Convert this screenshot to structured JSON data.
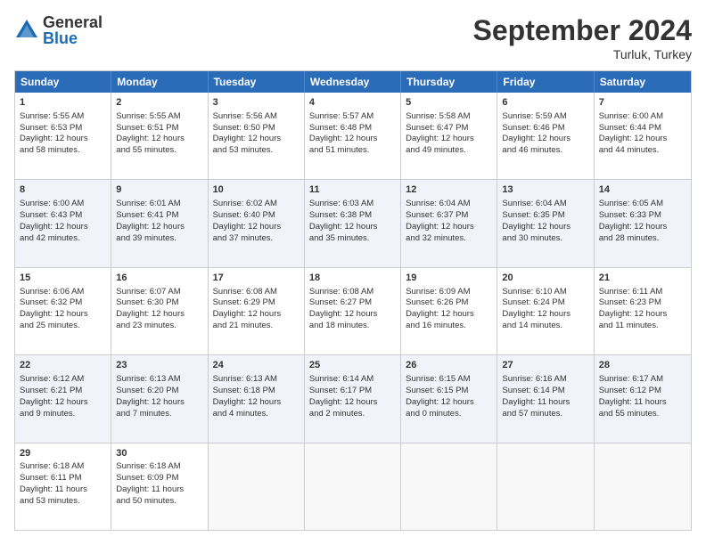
{
  "logo": {
    "general": "General",
    "blue": "Blue"
  },
  "header": {
    "month": "September 2024",
    "location": "Turluk, Turkey"
  },
  "weekdays": [
    "Sunday",
    "Monday",
    "Tuesday",
    "Wednesday",
    "Thursday",
    "Friday",
    "Saturday"
  ],
  "rows": [
    [
      {
        "day": "1",
        "info": "Sunrise: 5:55 AM\nSunset: 6:53 PM\nDaylight: 12 hours\nand 58 minutes."
      },
      {
        "day": "2",
        "info": "Sunrise: 5:55 AM\nSunset: 6:51 PM\nDaylight: 12 hours\nand 55 minutes."
      },
      {
        "day": "3",
        "info": "Sunrise: 5:56 AM\nSunset: 6:50 PM\nDaylight: 12 hours\nand 53 minutes."
      },
      {
        "day": "4",
        "info": "Sunrise: 5:57 AM\nSunset: 6:48 PM\nDaylight: 12 hours\nand 51 minutes."
      },
      {
        "day": "5",
        "info": "Sunrise: 5:58 AM\nSunset: 6:47 PM\nDaylight: 12 hours\nand 49 minutes."
      },
      {
        "day": "6",
        "info": "Sunrise: 5:59 AM\nSunset: 6:46 PM\nDaylight: 12 hours\nand 46 minutes."
      },
      {
        "day": "7",
        "info": "Sunrise: 6:00 AM\nSunset: 6:44 PM\nDaylight: 12 hours\nand 44 minutes."
      }
    ],
    [
      {
        "day": "8",
        "info": "Sunrise: 6:00 AM\nSunset: 6:43 PM\nDaylight: 12 hours\nand 42 minutes."
      },
      {
        "day": "9",
        "info": "Sunrise: 6:01 AM\nSunset: 6:41 PM\nDaylight: 12 hours\nand 39 minutes."
      },
      {
        "day": "10",
        "info": "Sunrise: 6:02 AM\nSunset: 6:40 PM\nDaylight: 12 hours\nand 37 minutes."
      },
      {
        "day": "11",
        "info": "Sunrise: 6:03 AM\nSunset: 6:38 PM\nDaylight: 12 hours\nand 35 minutes."
      },
      {
        "day": "12",
        "info": "Sunrise: 6:04 AM\nSunset: 6:37 PM\nDaylight: 12 hours\nand 32 minutes."
      },
      {
        "day": "13",
        "info": "Sunrise: 6:04 AM\nSunset: 6:35 PM\nDaylight: 12 hours\nand 30 minutes."
      },
      {
        "day": "14",
        "info": "Sunrise: 6:05 AM\nSunset: 6:33 PM\nDaylight: 12 hours\nand 28 minutes."
      }
    ],
    [
      {
        "day": "15",
        "info": "Sunrise: 6:06 AM\nSunset: 6:32 PM\nDaylight: 12 hours\nand 25 minutes."
      },
      {
        "day": "16",
        "info": "Sunrise: 6:07 AM\nSunset: 6:30 PM\nDaylight: 12 hours\nand 23 minutes."
      },
      {
        "day": "17",
        "info": "Sunrise: 6:08 AM\nSunset: 6:29 PM\nDaylight: 12 hours\nand 21 minutes."
      },
      {
        "day": "18",
        "info": "Sunrise: 6:08 AM\nSunset: 6:27 PM\nDaylight: 12 hours\nand 18 minutes."
      },
      {
        "day": "19",
        "info": "Sunrise: 6:09 AM\nSunset: 6:26 PM\nDaylight: 12 hours\nand 16 minutes."
      },
      {
        "day": "20",
        "info": "Sunrise: 6:10 AM\nSunset: 6:24 PM\nDaylight: 12 hours\nand 14 minutes."
      },
      {
        "day": "21",
        "info": "Sunrise: 6:11 AM\nSunset: 6:23 PM\nDaylight: 12 hours\nand 11 minutes."
      }
    ],
    [
      {
        "day": "22",
        "info": "Sunrise: 6:12 AM\nSunset: 6:21 PM\nDaylight: 12 hours\nand 9 minutes."
      },
      {
        "day": "23",
        "info": "Sunrise: 6:13 AM\nSunset: 6:20 PM\nDaylight: 12 hours\nand 7 minutes."
      },
      {
        "day": "24",
        "info": "Sunrise: 6:13 AM\nSunset: 6:18 PM\nDaylight: 12 hours\nand 4 minutes."
      },
      {
        "day": "25",
        "info": "Sunrise: 6:14 AM\nSunset: 6:17 PM\nDaylight: 12 hours\nand 2 minutes."
      },
      {
        "day": "26",
        "info": "Sunrise: 6:15 AM\nSunset: 6:15 PM\nDaylight: 12 hours\nand 0 minutes."
      },
      {
        "day": "27",
        "info": "Sunrise: 6:16 AM\nSunset: 6:14 PM\nDaylight: 11 hours\nand 57 minutes."
      },
      {
        "day": "28",
        "info": "Sunrise: 6:17 AM\nSunset: 6:12 PM\nDaylight: 11 hours\nand 55 minutes."
      }
    ],
    [
      {
        "day": "29",
        "info": "Sunrise: 6:18 AM\nSunset: 6:11 PM\nDaylight: 11 hours\nand 53 minutes."
      },
      {
        "day": "30",
        "info": "Sunrise: 6:18 AM\nSunset: 6:09 PM\nDaylight: 11 hours\nand 50 minutes."
      },
      {
        "day": "",
        "info": ""
      },
      {
        "day": "",
        "info": ""
      },
      {
        "day": "",
        "info": ""
      },
      {
        "day": "",
        "info": ""
      },
      {
        "day": "",
        "info": ""
      }
    ]
  ]
}
